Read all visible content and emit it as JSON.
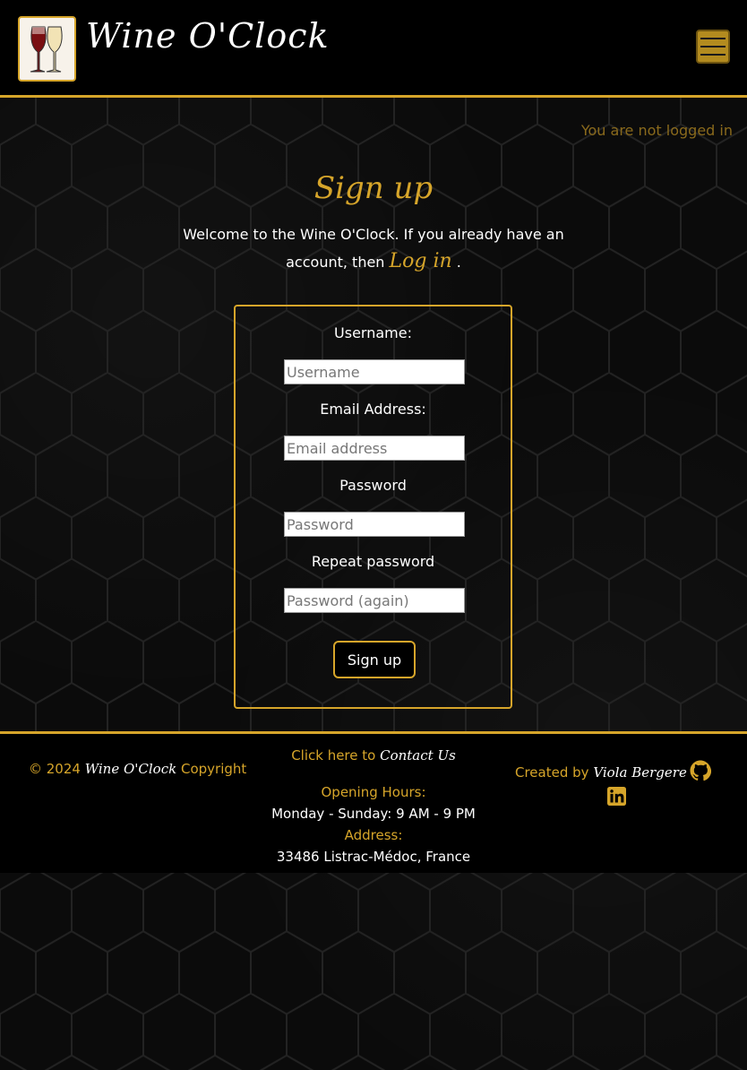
{
  "header": {
    "brand": "Wine O'Clock",
    "logo_icon": "wine-glasses-logo",
    "menu_icon": "hamburger-icon"
  },
  "auth": {
    "status": "You are not logged in"
  },
  "signup": {
    "title": "Sign up",
    "intro_text": "Welcome to the Wine O'Clock. If you already have an account, then",
    "login_link": "Log in",
    "intro_end": "."
  },
  "form": {
    "username_label": "Username:",
    "username_placeholder": "Username",
    "email_label": "Email Address:",
    "email_placeholder": "Email address",
    "password_label": "Password",
    "password_placeholder": "Password",
    "repeat_label": "Repeat password",
    "repeat_placeholder": "Password (again)",
    "submit_label": "Sign up"
  },
  "footer": {
    "copyright_prefix": "© 2024",
    "copyright_brand": "Wine O'Clock",
    "copyright_suffix": "Copyright",
    "contact_prefix": "Click here to",
    "contact_link": "Contact Us",
    "hours_label": "Opening Hours:",
    "hours_value": "Monday - Sunday: 9 AM - 9 PM",
    "address_label": "Address:",
    "address_value": "33486 Listrac-Médoc, France",
    "creator_prefix": "Created by",
    "creator_name": "Viola Bergere",
    "github_icon": "github-icon",
    "linkedin_icon": "linkedin-icon"
  },
  "colors": {
    "accent": "#d6a52a",
    "background": "#0b0b0b",
    "menu_button": "#b38b1f"
  }
}
